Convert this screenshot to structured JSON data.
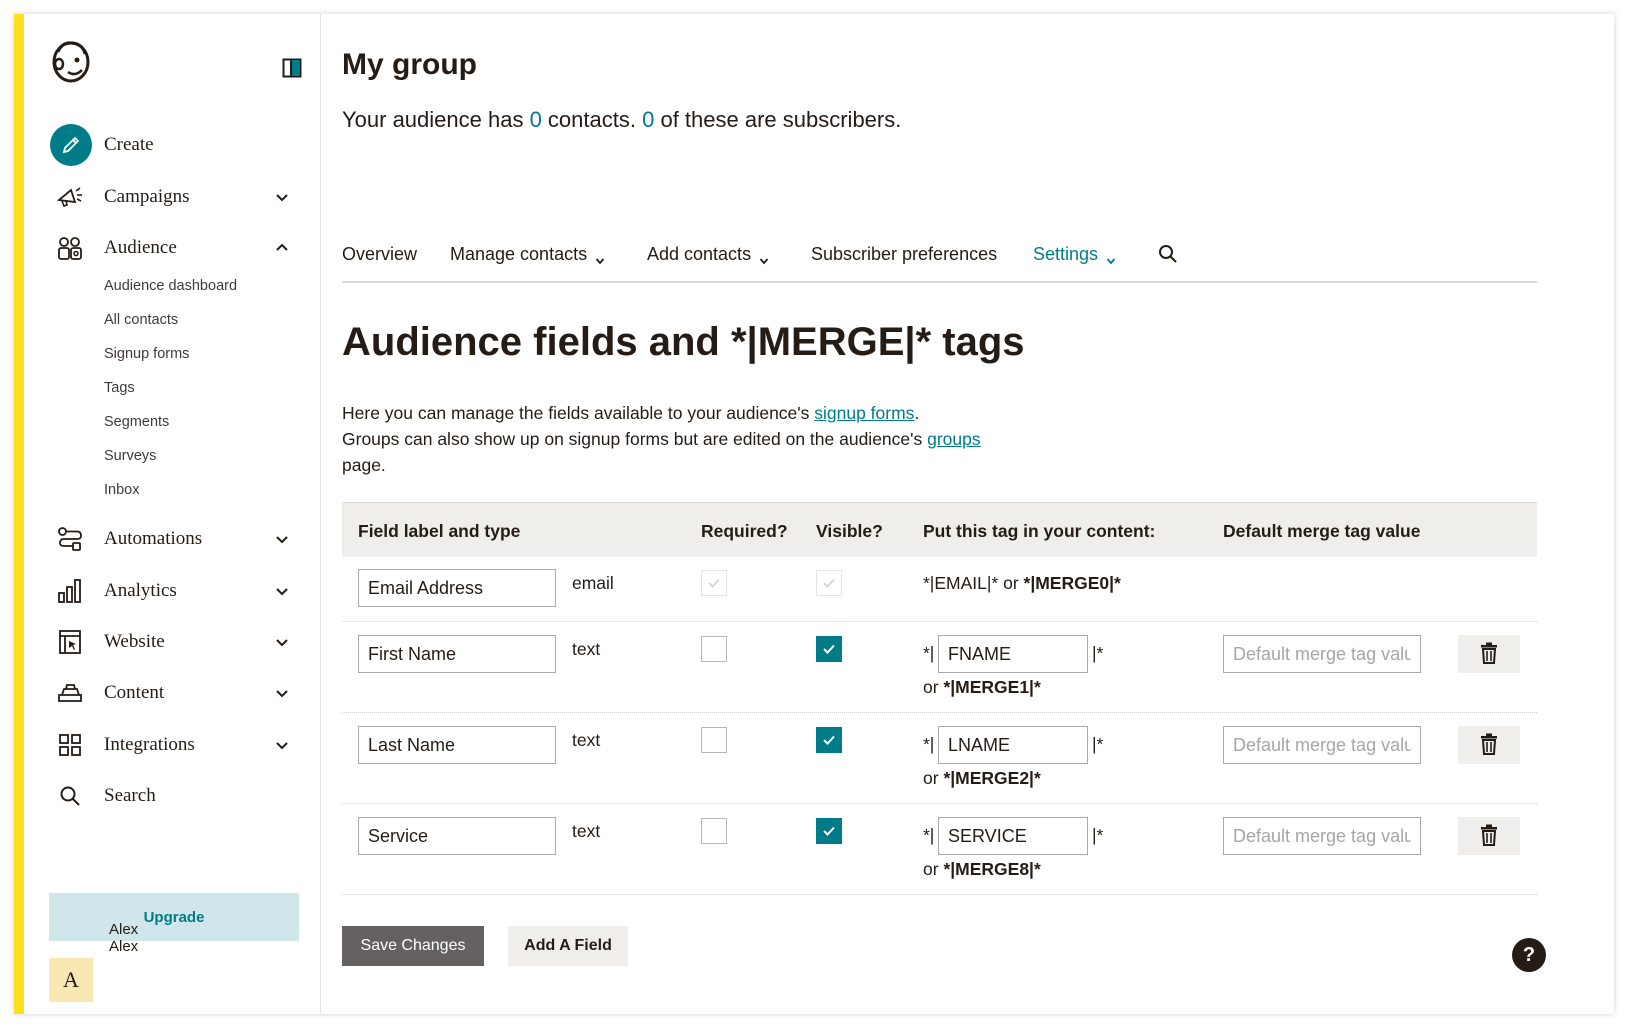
{
  "sidebar": {
    "create_label": "Create",
    "nav": {
      "campaigns": "Campaigns",
      "audience": "Audience",
      "automations": "Automations",
      "analytics": "Analytics",
      "website": "Website",
      "content": "Content",
      "integrations": "Integrations",
      "search": "Search"
    },
    "audience_sub": [
      "Audience dashboard",
      "All contacts",
      "Signup forms",
      "Tags",
      "Segments",
      "Surveys",
      "Inbox"
    ],
    "upgrade_label": "Upgrade",
    "user": {
      "initial": "A",
      "name": "Alex",
      "account": "Alex"
    }
  },
  "header": {
    "title": "My group",
    "audience_prefix": "Your audience has ",
    "contacts_count": "0",
    "audience_middle": " contacts. ",
    "subscribers_count": "0",
    "audience_suffix": " of these are subscribers."
  },
  "tabs": {
    "overview": "Overview",
    "manage_contacts": "Manage contacts",
    "add_contacts": "Add contacts",
    "subscriber_preferences": "Subscriber preferences",
    "settings": "Settings",
    "active": "settings"
  },
  "section": {
    "title": "Audience fields and *|MERGE|* tags",
    "desc_1": "Here you can manage the fields available to your audience's ",
    "link_signup": "signup forms",
    "desc_2": ".",
    "desc_3": "Groups can also show up on signup forms but are edited on the audience's ",
    "link_groups": "groups",
    "desc_4": "page."
  },
  "table": {
    "headers": {
      "field": "Field label and type",
      "required": "Required?",
      "visible": "Visible?",
      "tag": "Put this tag in your content:",
      "default": "Default merge tag value"
    },
    "email_row": {
      "label": "Email Address",
      "type": "email",
      "tag_plain": "*|EMAIL|* or ",
      "tag_bold": "*|MERGE0|*"
    },
    "rows": [
      {
        "label": "First Name",
        "type": "text",
        "required": false,
        "visible": true,
        "tag_prefix": "*|",
        "tag": "FNAME",
        "tag_suffix": "|*",
        "alt_prefix": "or ",
        "alt_tag": "*|MERGE1|*",
        "default_placeholder": "Default merge tag value"
      },
      {
        "label": "Last Name",
        "type": "text",
        "required": false,
        "visible": true,
        "tag_prefix": "*|",
        "tag": "LNAME",
        "tag_suffix": "|*",
        "alt_prefix": "or ",
        "alt_tag": "*|MERGE2|*",
        "default_placeholder": "Default merge tag value"
      },
      {
        "label": "Service",
        "type": "text",
        "required": false,
        "visible": true,
        "tag_prefix": "*|",
        "tag": "SERVICE",
        "tag_suffix": "|*",
        "alt_prefix": "or ",
        "alt_tag": "*|MERGE8|*",
        "default_placeholder": "Default merge tag value"
      }
    ]
  },
  "actions": {
    "save": "Save Changes",
    "add_field": "Add A Field",
    "help": "?"
  },
  "colors": {
    "accent": "#007c89",
    "brand_yellow": "#ffe01b",
    "upgrade_bg": "#d0e6ea"
  },
  "icons": {
    "logo": "freddie-logo",
    "collapse": "sidebar-collapse-icon",
    "create": "pencil-icon",
    "campaigns": "megaphone-icon",
    "audience": "audience-icon",
    "automations": "automation-flow-icon",
    "analytics": "bar-chart-icon",
    "website": "website-icon",
    "content": "content-stack-icon",
    "integrations": "grid-icon",
    "search": "search-icon",
    "delete": "trash-icon"
  }
}
